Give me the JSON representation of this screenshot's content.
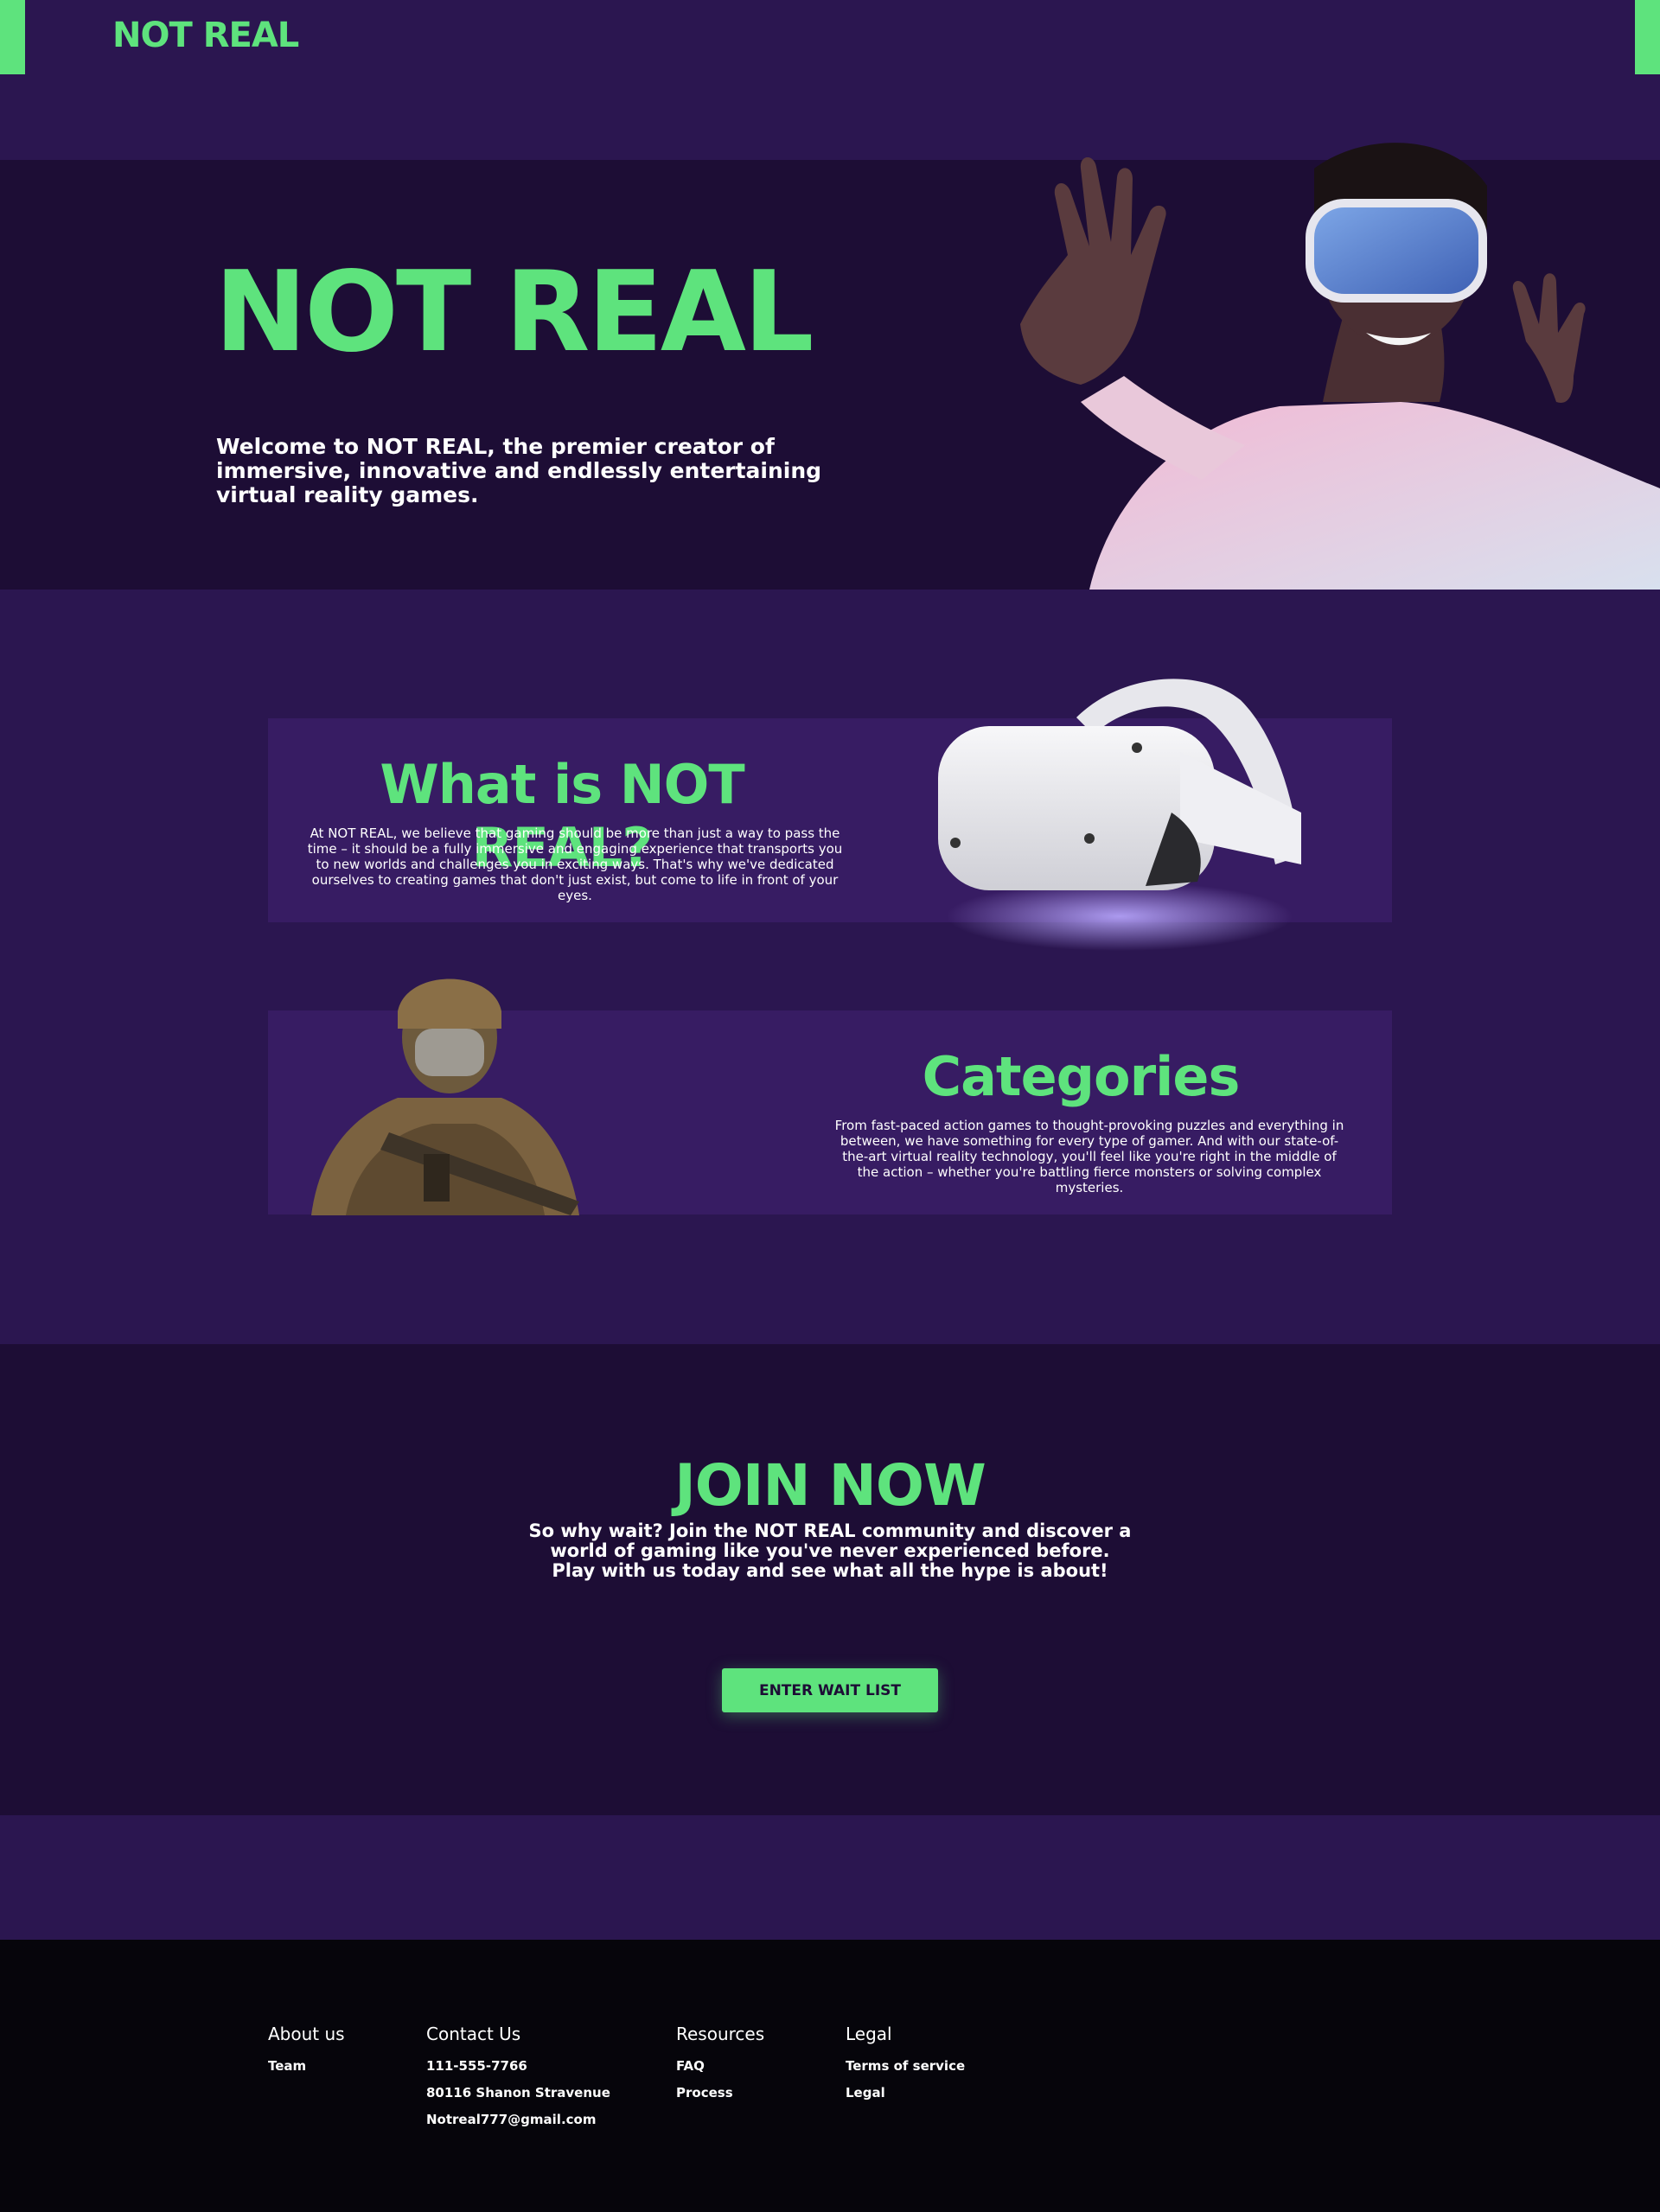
{
  "header": {
    "logo": "NOT REAL"
  },
  "hero": {
    "title": "NOT REAL",
    "text": "Welcome to NOT REAL, the premier creator of immersive, innovative and endlessly entertaining virtual reality games."
  },
  "what": {
    "title": "What is NOT REAL?",
    "text": "At NOT REAL, we believe that gaming should be more than just a way to pass the time – it should be a fully immersive and engaging experience that transports you to new worlds and challenges you in exciting ways. That's why we've dedicated ourselves to creating games that don't just exist, but come to life in front of your eyes."
  },
  "categories": {
    "title": "Categories",
    "text": "From fast-paced action games to thought-provoking puzzles and everything in between, we have something for every type of gamer. And with our state-of-the-art virtual reality technology, you'll feel like you're right in the middle of the action – whether you're battling fierce monsters or solving complex mysteries."
  },
  "join": {
    "title": "JOIN NOW",
    "text": "So why wait? Join the NOT REAL community and discover a world of gaming like you've never experienced before. Play with us today and see what all the hype is about!",
    "button": "ENTER WAIT LIST"
  },
  "footer": {
    "about": {
      "heading": "About us",
      "links": [
        "Team"
      ]
    },
    "contact": {
      "heading": "Contact Us",
      "links": [
        "111-555-7766",
        "80116 Shanon Stravenue",
        "Notreal777@gmail.com"
      ]
    },
    "resources": {
      "heading": "Resources",
      "links": [
        "FAQ",
        "Process"
      ]
    },
    "legal": {
      "heading": "Legal",
      "links": [
        "Terms of service",
        "Legal"
      ]
    }
  },
  "colors": {
    "accent": "#5ee37d",
    "bg": "#2b1650",
    "dark": "#1d0d35",
    "card": "#371c63",
    "footer": "#06050b"
  }
}
